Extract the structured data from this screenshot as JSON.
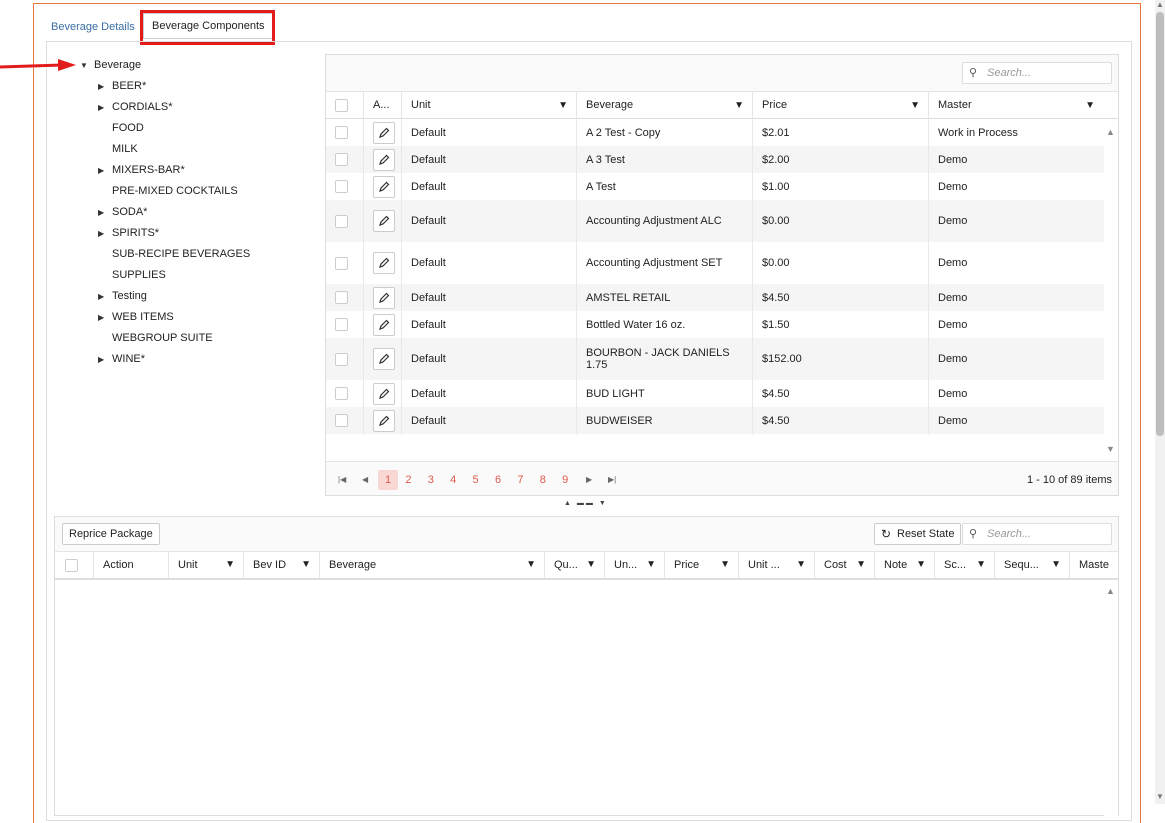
{
  "tabs": [
    {
      "label": "Beverage Details",
      "active": false
    },
    {
      "label": "Beverage Components",
      "active": true
    }
  ],
  "tree": {
    "root": "Beverage",
    "items": [
      {
        "label": "BEER*",
        "expandable": true
      },
      {
        "label": "CORDIALS*",
        "expandable": true
      },
      {
        "label": "FOOD",
        "expandable": false
      },
      {
        "label": "MILK",
        "expandable": false
      },
      {
        "label": "MIXERS-BAR*",
        "expandable": true
      },
      {
        "label": "PRE-MIXED COCKTAILS",
        "expandable": false
      },
      {
        "label": "SODA*",
        "expandable": true
      },
      {
        "label": "SPIRITS*",
        "expandable": true
      },
      {
        "label": "SUB-RECIPE BEVERAGES",
        "expandable": false
      },
      {
        "label": "SUPPLIES",
        "expandable": false
      },
      {
        "label": "Testing",
        "expandable": true
      },
      {
        "label": "WEB ITEMS",
        "expandable": true
      },
      {
        "label": "WEBGROUP SUITE",
        "expandable": false
      },
      {
        "label": "WINE*",
        "expandable": true
      }
    ]
  },
  "grid1": {
    "search_placeholder": "Search...",
    "columns": [
      "A...",
      "Unit",
      "Beverage",
      "Price",
      "Master"
    ],
    "rows": [
      [
        "Default",
        "A 2 Test - Copy",
        "$2.01",
        "Work in Process"
      ],
      [
        "Default",
        "A 3 Test",
        "$2.00",
        "Demo"
      ],
      [
        "Default",
        "A Test",
        "$1.00",
        "Demo"
      ],
      [
        "Default",
        "Accounting Adjustment ALC",
        "$0.00",
        "Demo"
      ],
      [
        "Default",
        "Accounting Adjustment SET",
        "$0.00",
        "Demo"
      ],
      [
        "Default",
        "AMSTEL RETAIL",
        "$4.50",
        "Demo"
      ],
      [
        "Default",
        "Bottled Water 16 oz.",
        "$1.50",
        "Demo"
      ],
      [
        "Default",
        "BOURBON - JACK DANIELS 1.75",
        "$152.00",
        "Demo"
      ],
      [
        "Default",
        "BUD LIGHT",
        "$4.50",
        "Demo"
      ],
      [
        "Default",
        "BUDWEISER",
        "$4.50",
        "Demo"
      ]
    ],
    "pager": {
      "pages": [
        "1",
        "2",
        "3",
        "4",
        "5",
        "6",
        "7",
        "8",
        "9"
      ],
      "current": "1",
      "info": "1 - 10 of 89 items"
    }
  },
  "grid2": {
    "reprice_label": "Reprice Package",
    "reset_label": "Reset State",
    "search_placeholder": "Search...",
    "columns": [
      "Action",
      "Unit",
      "Bev ID",
      "Beverage",
      "Qu...",
      "Un...",
      "Price",
      "Unit ...",
      "Cost",
      "Note",
      "Sc...",
      "Sequ...",
      "Maste"
    ]
  },
  "colors": {
    "accent": "#e05a4a",
    "highlight": "#e21b1b",
    "frame": "#e6783c"
  }
}
